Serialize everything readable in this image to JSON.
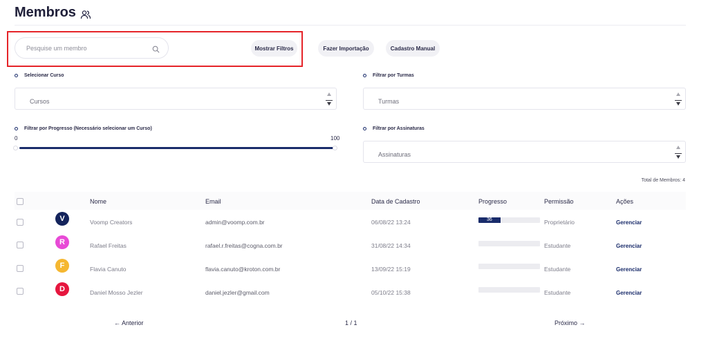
{
  "header": {
    "title": "Membros",
    "icon": "users-icon"
  },
  "toolbar": {
    "search_placeholder": "Pesquise um membro",
    "show_filters": "Mostrar Filtros",
    "import": "Fazer Importação",
    "manual": "Cadastro Manual"
  },
  "filters": {
    "course_label": "Selecionar Curso",
    "course_value": "Cursos",
    "class_label": "Filtrar por Turmas",
    "class_value": "Turmas",
    "progress_label": "Filtrar por Progresso (Necessário selecionar um Curso)",
    "progress_min": "0",
    "progress_max": "100",
    "subs_label": "Filtrar por Assinaturas",
    "subs_value": "Assinaturas"
  },
  "total_label": "Total de Membros: 4",
  "table": {
    "headers": [
      "Nome",
      "Email",
      "Data de Cadastro",
      "Progresso",
      "Permissão",
      "Ações"
    ],
    "rows": [
      {
        "initial": "V",
        "color": "#14245c",
        "name": "Voomp Creators",
        "email": "admin@voomp.com.br",
        "date": "06/08/22 13:24",
        "progress": 36,
        "progress_label": "36",
        "role": "Proprietário",
        "action": "Gerenciar"
      },
      {
        "initial": "R",
        "color": "#e84ad6",
        "name": "Rafael Freitas",
        "email": "rafael.r.freitas@cogna.com.br",
        "date": "31/08/22 14:34",
        "progress": 0,
        "progress_label": "",
        "role": "Estudante",
        "action": "Gerenciar"
      },
      {
        "initial": "F",
        "color": "#f5b731",
        "name": "Flavia Canuto",
        "email": "flavia.canuto@kroton.com.br",
        "date": "13/09/22 15:19",
        "progress": 0,
        "progress_label": "",
        "role": "Estudante",
        "action": "Gerenciar"
      },
      {
        "initial": "D",
        "color": "#e6163e",
        "name": "Daniel Mosso Jezler",
        "email": "daniel.jezler@gmail.com",
        "date": "05/10/22 15:38",
        "progress": 0,
        "progress_label": "",
        "role": "Estudante",
        "action": "Gerenciar"
      }
    ]
  },
  "pagination": {
    "prev": "← Anterior",
    "page": "1 / 1",
    "next": "Próximo →"
  }
}
